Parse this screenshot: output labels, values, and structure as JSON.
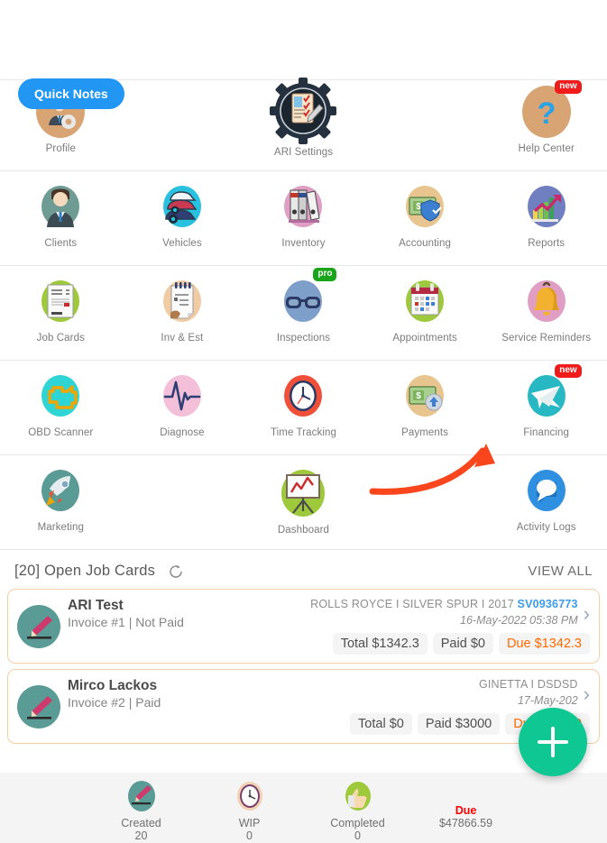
{
  "quick_notes": {
    "label": "Quick Notes",
    "color": "#2196f3"
  },
  "grid": {
    "rows": [
      {
        "cells": [
          {
            "label": "Profile",
            "icon": "profile-gear-icon",
            "badge": null
          },
          {
            "label": "",
            "icon": null,
            "empty": true
          },
          {
            "label": "ARI Settings",
            "icon": "gear-clipboard-icon",
            "badge": null
          },
          {
            "label": "",
            "icon": null,
            "empty": true
          },
          {
            "label": "Help Center",
            "icon": "question-mark-icon",
            "badge": "new"
          }
        ]
      },
      {
        "cells": [
          {
            "label": "Clients",
            "icon": "person-suit-icon",
            "badge": null
          },
          {
            "label": "Vehicles",
            "icon": "cars-icon",
            "badge": null
          },
          {
            "label": "Inventory",
            "icon": "binders-icon",
            "badge": null
          },
          {
            "label": "Accounting",
            "icon": "money-shield-icon",
            "badge": null
          },
          {
            "label": "Reports",
            "icon": "bar-chart-arrow-icon",
            "badge": null
          }
        ]
      },
      {
        "cells": [
          {
            "label": "Job Cards",
            "icon": "document-lines-icon",
            "badge": null
          },
          {
            "label": "Inv & Est",
            "icon": "notepad-icon",
            "badge": null
          },
          {
            "label": "Inspections",
            "icon": "glasses-icon",
            "badge": "pro"
          },
          {
            "label": "Appointments",
            "icon": "calendar-icon",
            "badge": null
          },
          {
            "label": "Service Reminders",
            "icon": "bell-icon",
            "badge": null
          }
        ]
      },
      {
        "cells": [
          {
            "label": "OBD Scanner",
            "icon": "engine-icon",
            "badge": null
          },
          {
            "label": "Diagnose",
            "icon": "pulse-icon",
            "badge": null
          },
          {
            "label": "Time Tracking",
            "icon": "clock-icon",
            "badge": null
          },
          {
            "label": "Payments",
            "icon": "money-arrow-icon",
            "badge": null
          },
          {
            "label": "Financing",
            "icon": "paper-plane-icon",
            "badge": "new"
          }
        ]
      },
      {
        "cells": [
          {
            "label": "Marketing",
            "icon": "rocket-icon",
            "badge": null
          },
          {
            "label": "",
            "icon": null,
            "empty": true
          },
          {
            "label": "Dashboard",
            "icon": "easel-chart-icon",
            "badge": null
          },
          {
            "label": "",
            "icon": null,
            "empty": true
          },
          {
            "label": "Activity Logs",
            "icon": "chat-bubble-icon",
            "badge": null
          }
        ]
      }
    ]
  },
  "badges": {
    "new": "new",
    "pro": "pro"
  },
  "jobs": {
    "header_title": "[20] Open Job Cards",
    "view_all": "VIEW ALL",
    "cards": [
      {
        "name": "ARI Test",
        "subtitle": "Invoice #1 | Not Paid",
        "vehicle": "ROLLS ROYCE I SILVER SPUR I 2017 ",
        "sv": "SV0936773",
        "date": "16-May-2022 05:38 PM",
        "total": "Total $1342.3",
        "paid": "Paid $0",
        "due": "Due $1342.3"
      },
      {
        "name": "Mirco Lackos",
        "subtitle": "Invoice #2 | Paid",
        "vehicle": "GINETTA I DSDSD",
        "sv": "",
        "date": "17-May-202",
        "total": "Total $0",
        "paid": "Paid $3000",
        "due": "Due $-3000"
      }
    ]
  },
  "bottom_bar": {
    "stats": [
      {
        "label": "Created",
        "value": "20",
        "icon": "pencil-icon"
      },
      {
        "label": "WIP",
        "value": "0",
        "icon": "clock-icon"
      },
      {
        "label": "Completed",
        "value": "0",
        "icon": "thumbs-up-icon"
      },
      {
        "label": "Due",
        "value": "$47866.59",
        "icon": null
      }
    ]
  },
  "fab": {
    "label": "+",
    "color": "#0fc793"
  },
  "annotation": {
    "color": "#f9461c",
    "points_to": "Financing"
  }
}
